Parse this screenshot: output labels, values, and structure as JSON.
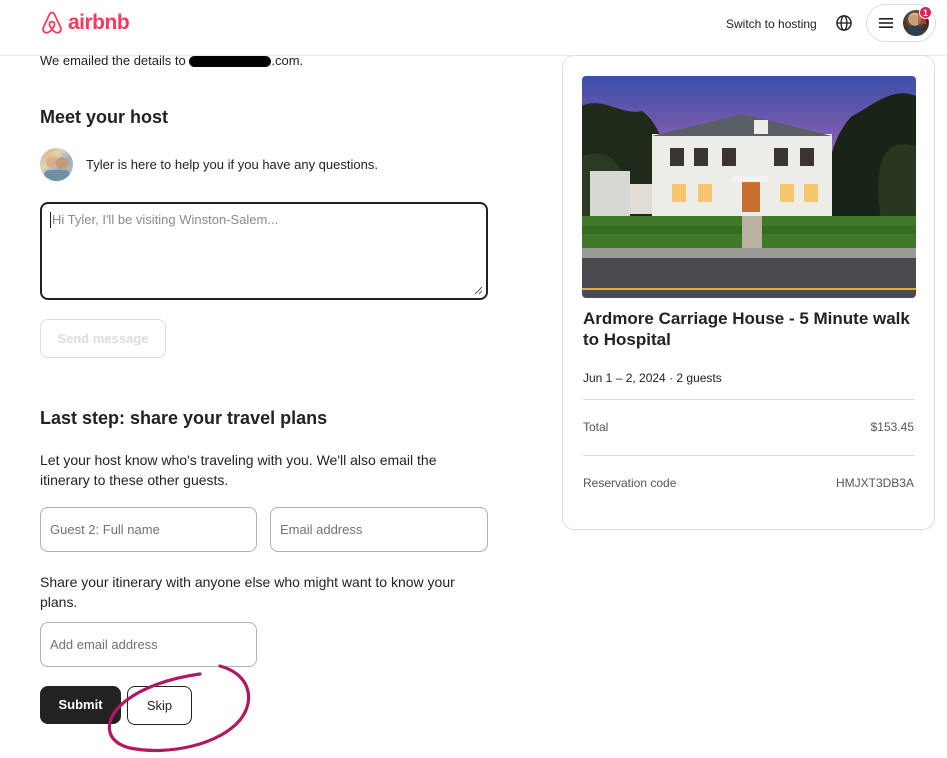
{
  "header": {
    "brand": "airbnb",
    "switch_hosting": "Switch to hosting",
    "notification_count": "1",
    "brand_color": "#FF385C"
  },
  "confirmation": {
    "emailed_prefix": "We emailed the details to",
    "emailed_suffix": ".com."
  },
  "host": {
    "heading": "Meet your host",
    "help_text": "Tyler is here to help you if you have any questions.",
    "message_placeholder": "Hi Tyler, I'll be visiting Winston-Salem...",
    "send_label": "Send message"
  },
  "travel_plans": {
    "heading": "Last step: share your travel plans",
    "description": "Let your host know who's traveling with you. We'll also email the itinerary to these other guests.",
    "guest_name_placeholder": "Guest 2: Full name",
    "guest_email_placeholder": "Email address",
    "share_description": "Share your itinerary with anyone else who might want to know your plans.",
    "add_email_placeholder": "Add email address",
    "submit_label": "Submit",
    "skip_label": "Skip"
  },
  "listing": {
    "title": "Ardmore Carriage House - 5 Minute walk to Hospital",
    "dates": "Jun 1 – 2, 2024 · 2 guests",
    "total_label": "Total",
    "total_value": "$153.45",
    "reservation_label": "Reservation code",
    "reservation_value": "HMJXT3DB3A"
  },
  "icons": {
    "logo": "airbnb-logo-icon",
    "globe": "globe-icon",
    "menu": "hamburger-icon",
    "avatar": "user-avatar"
  },
  "annotation_color": "#B0195F"
}
